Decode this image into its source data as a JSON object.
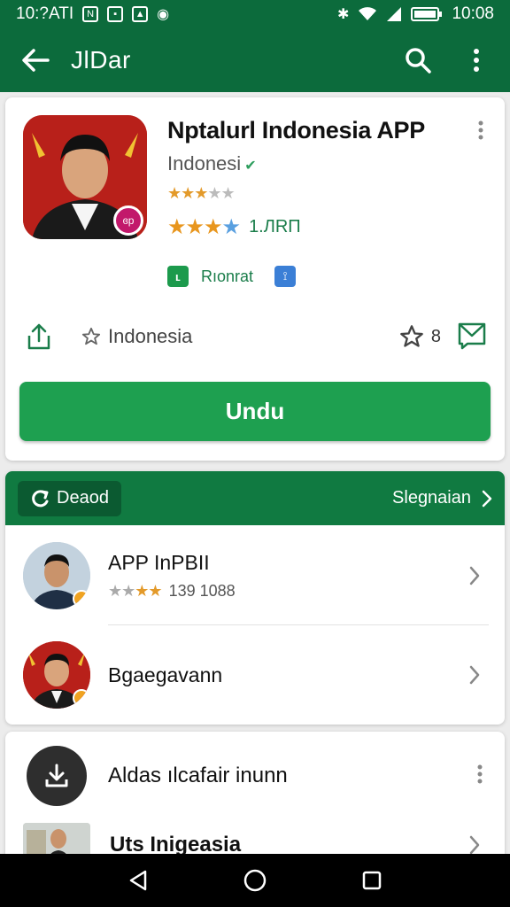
{
  "status_bar": {
    "left_time": "10:?ATI",
    "right_time": "10:08",
    "icons": [
      "notification-icon",
      "app-icon",
      "gallery-icon",
      "eye-icon",
      "bluetooth-icon",
      "wifi-icon",
      "signal-icon",
      "battery-icon"
    ]
  },
  "app_bar": {
    "title": "JlDar",
    "back_icon": "arrow-back-icon",
    "search_icon": "search-icon",
    "menu_icon": "more-vert-icon"
  },
  "app": {
    "name": "Nptalurl Indonesia  APP",
    "publisher": "Indonesi",
    "verified_mark": "✔",
    "badge_text": "ɞp",
    "rating_count": "1.ЛRП",
    "chip_1_glyph": "ʟ",
    "chip_label": "Rıonrat",
    "chip_2_glyph": "⟟",
    "category": "Indonesia",
    "favorites_count": "8",
    "install_label": "Undu"
  },
  "related": {
    "tag_label": "Deaod",
    "see_more_label": "Slegnaian",
    "items": [
      {
        "title": "APP InPBII",
        "sub": "139 1088"
      },
      {
        "title": "Bgaegavann"
      }
    ]
  },
  "more": {
    "items": [
      {
        "title": "Aldas ılcafair inunn"
      },
      {
        "title": "Uts Inigeasia"
      }
    ]
  },
  "colors": {
    "primary": "#0c6b3c",
    "accent": "#1ea050",
    "section": "#107a41",
    "star": "#e8961e"
  }
}
